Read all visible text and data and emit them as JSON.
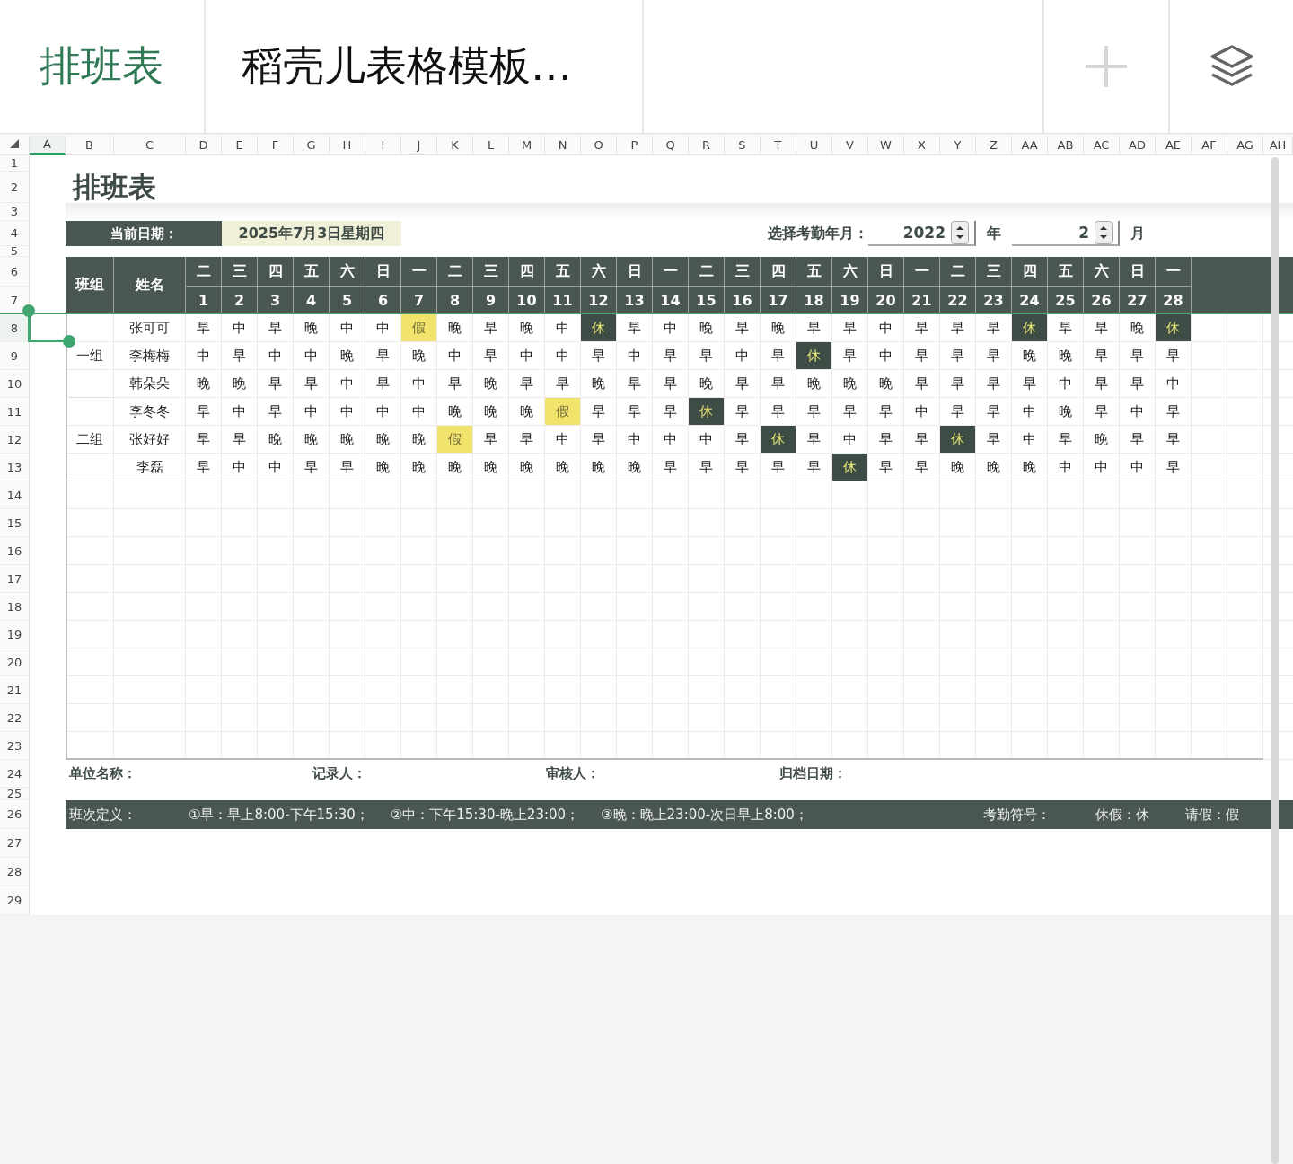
{
  "app_bar": {
    "title": "排班表",
    "document_name": "稻壳儿表格模板…"
  },
  "columns": [
    {
      "label": "A",
      "selected": true
    },
    {
      "label": "B",
      "selected": false
    },
    {
      "label": "C",
      "selected": false
    },
    {
      "label": "D",
      "selected": false
    },
    {
      "label": "E",
      "selected": false
    },
    {
      "label": "F",
      "selected": false
    },
    {
      "label": "G",
      "selected": false
    },
    {
      "label": "H",
      "selected": false
    },
    {
      "label": "I",
      "selected": false
    },
    {
      "label": "J",
      "selected": false
    },
    {
      "label": "K",
      "selected": false
    },
    {
      "label": "L",
      "selected": false
    },
    {
      "label": "M",
      "selected": false
    },
    {
      "label": "N",
      "selected": false
    },
    {
      "label": "O",
      "selected": false
    },
    {
      "label": "P",
      "selected": false
    },
    {
      "label": "Q",
      "selected": false
    },
    {
      "label": "R",
      "selected": false
    },
    {
      "label": "S",
      "selected": false
    },
    {
      "label": "T",
      "selected": false
    },
    {
      "label": "U",
      "selected": false
    },
    {
      "label": "V",
      "selected": false
    },
    {
      "label": "W",
      "selected": false
    },
    {
      "label": "X",
      "selected": false
    },
    {
      "label": "Y",
      "selected": false
    },
    {
      "label": "Z",
      "selected": false
    },
    {
      "label": "AA",
      "selected": false
    },
    {
      "label": "AB",
      "selected": false
    },
    {
      "label": "AC",
      "selected": false
    },
    {
      "label": "AD",
      "selected": false
    },
    {
      "label": "AE",
      "selected": false
    },
    {
      "label": "AF",
      "selected": false
    },
    {
      "label": "AG",
      "selected": false
    },
    {
      "label": "AH",
      "selected": false
    }
  ],
  "rows": [
    {
      "label": "1",
      "selected": false
    },
    {
      "label": "2",
      "selected": false
    },
    {
      "label": "3",
      "selected": false
    },
    {
      "label": "4",
      "selected": false
    },
    {
      "label": "5",
      "selected": false
    },
    {
      "label": "6",
      "selected": false
    },
    {
      "label": "7",
      "selected": false
    },
    {
      "label": "8",
      "selected": true
    },
    {
      "label": "9",
      "selected": false
    },
    {
      "label": "10",
      "selected": false
    },
    {
      "label": "11",
      "selected": false
    },
    {
      "label": "12",
      "selected": false
    },
    {
      "label": "13",
      "selected": false
    },
    {
      "label": "14",
      "selected": false
    },
    {
      "label": "15",
      "selected": false
    },
    {
      "label": "16",
      "selected": false
    },
    {
      "label": "17",
      "selected": false
    },
    {
      "label": "18",
      "selected": false
    },
    {
      "label": "19",
      "selected": false
    },
    {
      "label": "20",
      "selected": false
    },
    {
      "label": "21",
      "selected": false
    },
    {
      "label": "22",
      "selected": false
    },
    {
      "label": "23",
      "selected": false
    },
    {
      "label": "24",
      "selected": false
    },
    {
      "label": "25",
      "selected": false
    },
    {
      "label": "26",
      "selected": false
    },
    {
      "label": "27",
      "selected": false
    },
    {
      "label": "28",
      "selected": false
    },
    {
      "label": "29",
      "selected": false
    }
  ],
  "sheet": {
    "title": "排班表",
    "current_date_label": "当前日期：",
    "current_date": "2025年7月3日星期四",
    "period_label": "选择考勤年月：",
    "year": "2022",
    "year_unit": "年",
    "month": "2",
    "month_unit": "月",
    "header": {
      "group": "班组",
      "name": "姓名",
      "days": [
        {
          "weekday": "二",
          "date": "1"
        },
        {
          "weekday": "三",
          "date": "2"
        },
        {
          "weekday": "四",
          "date": "3"
        },
        {
          "weekday": "五",
          "date": "4"
        },
        {
          "weekday": "六",
          "date": "5"
        },
        {
          "weekday": "日",
          "date": "6"
        },
        {
          "weekday": "一",
          "date": "7"
        },
        {
          "weekday": "二",
          "date": "8"
        },
        {
          "weekday": "三",
          "date": "9"
        },
        {
          "weekday": "四",
          "date": "10"
        },
        {
          "weekday": "五",
          "date": "11"
        },
        {
          "weekday": "六",
          "date": "12"
        },
        {
          "weekday": "日",
          "date": "13"
        },
        {
          "weekday": "一",
          "date": "14"
        },
        {
          "weekday": "二",
          "date": "15"
        },
        {
          "weekday": "三",
          "date": "16"
        },
        {
          "weekday": "四",
          "date": "17"
        },
        {
          "weekday": "五",
          "date": "18"
        },
        {
          "weekday": "六",
          "date": "19"
        },
        {
          "weekday": "日",
          "date": "20"
        },
        {
          "weekday": "一",
          "date": "21"
        },
        {
          "weekday": "二",
          "date": "22"
        },
        {
          "weekday": "三",
          "date": "23"
        },
        {
          "weekday": "四",
          "date": "24"
        },
        {
          "weekday": "五",
          "date": "25"
        },
        {
          "weekday": "六",
          "date": "26"
        },
        {
          "weekday": "日",
          "date": "27"
        },
        {
          "weekday": "一",
          "date": "28"
        }
      ]
    },
    "groups": [
      {
        "name": "一组",
        "members": [
          {
            "name": "张可可",
            "shifts": [
              {
                "text": "早",
                "kind": "shift"
              },
              {
                "text": "中",
                "kind": "shift"
              },
              {
                "text": "早",
                "kind": "shift"
              },
              {
                "text": "晚",
                "kind": "shift"
              },
              {
                "text": "中",
                "kind": "shift"
              },
              {
                "text": "中",
                "kind": "shift"
              },
              {
                "text": "假",
                "kind": "leave"
              },
              {
                "text": "晚",
                "kind": "shift"
              },
              {
                "text": "早",
                "kind": "shift"
              },
              {
                "text": "晚",
                "kind": "shift"
              },
              {
                "text": "中",
                "kind": "shift"
              },
              {
                "text": "休",
                "kind": "rest"
              },
              {
                "text": "早",
                "kind": "shift"
              },
              {
                "text": "中",
                "kind": "shift"
              },
              {
                "text": "晚",
                "kind": "shift"
              },
              {
                "text": "早",
                "kind": "shift"
              },
              {
                "text": "晚",
                "kind": "shift"
              },
              {
                "text": "早",
                "kind": "shift"
              },
              {
                "text": "早",
                "kind": "shift"
              },
              {
                "text": "中",
                "kind": "shift"
              },
              {
                "text": "早",
                "kind": "shift"
              },
              {
                "text": "早",
                "kind": "shift"
              },
              {
                "text": "早",
                "kind": "shift"
              },
              {
                "text": "休",
                "kind": "rest"
              },
              {
                "text": "早",
                "kind": "shift"
              },
              {
                "text": "早",
                "kind": "shift"
              },
              {
                "text": "晚",
                "kind": "shift"
              },
              {
                "text": "休",
                "kind": "rest"
              }
            ]
          },
          {
            "name": "李梅梅",
            "shifts": [
              {
                "text": "中",
                "kind": "shift"
              },
              {
                "text": "早",
                "kind": "shift"
              },
              {
                "text": "中",
                "kind": "shift"
              },
              {
                "text": "中",
                "kind": "shift"
              },
              {
                "text": "晚",
                "kind": "shift"
              },
              {
                "text": "早",
                "kind": "shift"
              },
              {
                "text": "晚",
                "kind": "shift"
              },
              {
                "text": "中",
                "kind": "shift"
              },
              {
                "text": "早",
                "kind": "shift"
              },
              {
                "text": "中",
                "kind": "shift"
              },
              {
                "text": "中",
                "kind": "shift"
              },
              {
                "text": "早",
                "kind": "shift"
              },
              {
                "text": "中",
                "kind": "shift"
              },
              {
                "text": "早",
                "kind": "shift"
              },
              {
                "text": "早",
                "kind": "shift"
              },
              {
                "text": "中",
                "kind": "shift"
              },
              {
                "text": "早",
                "kind": "shift"
              },
              {
                "text": "休",
                "kind": "rest"
              },
              {
                "text": "早",
                "kind": "shift"
              },
              {
                "text": "中",
                "kind": "shift"
              },
              {
                "text": "早",
                "kind": "shift"
              },
              {
                "text": "早",
                "kind": "shift"
              },
              {
                "text": "早",
                "kind": "shift"
              },
              {
                "text": "晚",
                "kind": "shift"
              },
              {
                "text": "晚",
                "kind": "shift"
              },
              {
                "text": "早",
                "kind": "shift"
              },
              {
                "text": "早",
                "kind": "shift"
              },
              {
                "text": "早",
                "kind": "shift"
              }
            ]
          },
          {
            "name": "韩朵朵",
            "shifts": [
              {
                "text": "晚",
                "kind": "shift"
              },
              {
                "text": "晚",
                "kind": "shift"
              },
              {
                "text": "早",
                "kind": "shift"
              },
              {
                "text": "早",
                "kind": "shift"
              },
              {
                "text": "中",
                "kind": "shift"
              },
              {
                "text": "早",
                "kind": "shift"
              },
              {
                "text": "中",
                "kind": "shift"
              },
              {
                "text": "早",
                "kind": "shift"
              },
              {
                "text": "晚",
                "kind": "shift"
              },
              {
                "text": "早",
                "kind": "shift"
              },
              {
                "text": "早",
                "kind": "shift"
              },
              {
                "text": "晚",
                "kind": "shift"
              },
              {
                "text": "早",
                "kind": "shift"
              },
              {
                "text": "早",
                "kind": "shift"
              },
              {
                "text": "晚",
                "kind": "shift"
              },
              {
                "text": "早",
                "kind": "shift"
              },
              {
                "text": "早",
                "kind": "shift"
              },
              {
                "text": "晚",
                "kind": "shift"
              },
              {
                "text": "晚",
                "kind": "shift"
              },
              {
                "text": "晚",
                "kind": "shift"
              },
              {
                "text": "早",
                "kind": "shift"
              },
              {
                "text": "早",
                "kind": "shift"
              },
              {
                "text": "早",
                "kind": "shift"
              },
              {
                "text": "早",
                "kind": "shift"
              },
              {
                "text": "中",
                "kind": "shift"
              },
              {
                "text": "早",
                "kind": "shift"
              },
              {
                "text": "早",
                "kind": "shift"
              },
              {
                "text": "中",
                "kind": "shift"
              }
            ]
          }
        ]
      },
      {
        "name": "二组",
        "members": [
          {
            "name": "李冬冬",
            "shifts": [
              {
                "text": "早",
                "kind": "shift"
              },
              {
                "text": "中",
                "kind": "shift"
              },
              {
                "text": "早",
                "kind": "shift"
              },
              {
                "text": "中",
                "kind": "shift"
              },
              {
                "text": "中",
                "kind": "shift"
              },
              {
                "text": "中",
                "kind": "shift"
              },
              {
                "text": "中",
                "kind": "shift"
              },
              {
                "text": "晚",
                "kind": "shift"
              },
              {
                "text": "晚",
                "kind": "shift"
              },
              {
                "text": "晚",
                "kind": "shift"
              },
              {
                "text": "假",
                "kind": "leave"
              },
              {
                "text": "早",
                "kind": "shift"
              },
              {
                "text": "早",
                "kind": "shift"
              },
              {
                "text": "早",
                "kind": "shift"
              },
              {
                "text": "休",
                "kind": "rest"
              },
              {
                "text": "早",
                "kind": "shift"
              },
              {
                "text": "早",
                "kind": "shift"
              },
              {
                "text": "早",
                "kind": "shift"
              },
              {
                "text": "早",
                "kind": "shift"
              },
              {
                "text": "早",
                "kind": "shift"
              },
              {
                "text": "中",
                "kind": "shift"
              },
              {
                "text": "早",
                "kind": "shift"
              },
              {
                "text": "早",
                "kind": "shift"
              },
              {
                "text": "中",
                "kind": "shift"
              },
              {
                "text": "晚",
                "kind": "shift"
              },
              {
                "text": "早",
                "kind": "shift"
              },
              {
                "text": "中",
                "kind": "shift"
              },
              {
                "text": "早",
                "kind": "shift"
              }
            ]
          },
          {
            "name": "张好好",
            "shifts": [
              {
                "text": "早",
                "kind": "shift"
              },
              {
                "text": "早",
                "kind": "shift"
              },
              {
                "text": "晚",
                "kind": "shift"
              },
              {
                "text": "晚",
                "kind": "shift"
              },
              {
                "text": "晚",
                "kind": "shift"
              },
              {
                "text": "晚",
                "kind": "shift"
              },
              {
                "text": "晚",
                "kind": "shift"
              },
              {
                "text": "假",
                "kind": "leave"
              },
              {
                "text": "早",
                "kind": "shift"
              },
              {
                "text": "早",
                "kind": "shift"
              },
              {
                "text": "中",
                "kind": "shift"
              },
              {
                "text": "早",
                "kind": "shift"
              },
              {
                "text": "中",
                "kind": "shift"
              },
              {
                "text": "中",
                "kind": "shift"
              },
              {
                "text": "中",
                "kind": "shift"
              },
              {
                "text": "早",
                "kind": "shift"
              },
              {
                "text": "休",
                "kind": "rest"
              },
              {
                "text": "早",
                "kind": "shift"
              },
              {
                "text": "中",
                "kind": "shift"
              },
              {
                "text": "早",
                "kind": "shift"
              },
              {
                "text": "早",
                "kind": "shift"
              },
              {
                "text": "休",
                "kind": "rest"
              },
              {
                "text": "早",
                "kind": "shift"
              },
              {
                "text": "中",
                "kind": "shift"
              },
              {
                "text": "早",
                "kind": "shift"
              },
              {
                "text": "晚",
                "kind": "shift"
              },
              {
                "text": "早",
                "kind": "shift"
              },
              {
                "text": "早",
                "kind": "shift"
              }
            ]
          },
          {
            "name": "李磊",
            "shifts": [
              {
                "text": "早",
                "kind": "shift"
              },
              {
                "text": "中",
                "kind": "shift"
              },
              {
                "text": "中",
                "kind": "shift"
              },
              {
                "text": "早",
                "kind": "shift"
              },
              {
                "text": "早",
                "kind": "shift"
              },
              {
                "text": "晚",
                "kind": "shift"
              },
              {
                "text": "晚",
                "kind": "shift"
              },
              {
                "text": "晚",
                "kind": "shift"
              },
              {
                "text": "晚",
                "kind": "shift"
              },
              {
                "text": "晚",
                "kind": "shift"
              },
              {
                "text": "晚",
                "kind": "shift"
              },
              {
                "text": "晚",
                "kind": "shift"
              },
              {
                "text": "晚",
                "kind": "shift"
              },
              {
                "text": "早",
                "kind": "shift"
              },
              {
                "text": "早",
                "kind": "shift"
              },
              {
                "text": "早",
                "kind": "shift"
              },
              {
                "text": "早",
                "kind": "shift"
              },
              {
                "text": "早",
                "kind": "shift"
              },
              {
                "text": "休",
                "kind": "rest"
              },
              {
                "text": "早",
                "kind": "shift"
              },
              {
                "text": "早",
                "kind": "shift"
              },
              {
                "text": "晚",
                "kind": "shift"
              },
              {
                "text": "晚",
                "kind": "shift"
              },
              {
                "text": "晚",
                "kind": "shift"
              },
              {
                "text": "中",
                "kind": "shift"
              },
              {
                "text": "中",
                "kind": "shift"
              },
              {
                "text": "中",
                "kind": "shift"
              },
              {
                "text": "早",
                "kind": "shift"
              }
            ]
          }
        ]
      }
    ],
    "footer_fields": [
      "单位名称：",
      "记录人：",
      "审核人：",
      "归档日期："
    ],
    "legend": {
      "label": "班次定义：",
      "items": [
        "①早：早上8:00-下午15:30；",
        "②中：下午15:30-晚上23:00；",
        "③晚：晚上23:00-次日早上8:00；"
      ],
      "symbols_label": "考勤符号：",
      "symbols": [
        "休假：休",
        "请假：假"
      ]
    }
  }
}
